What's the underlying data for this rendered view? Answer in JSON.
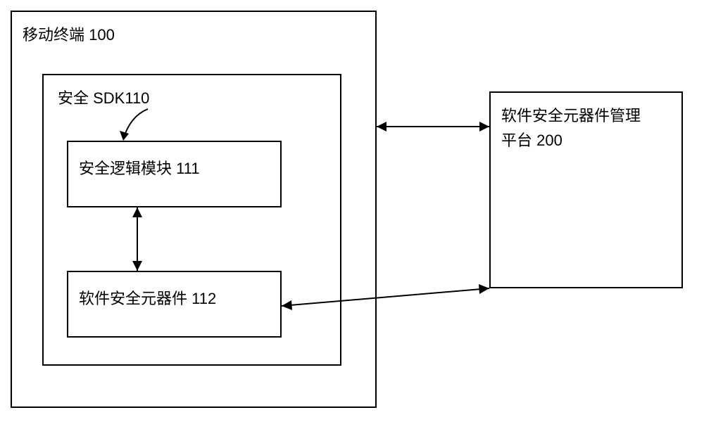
{
  "terminal": {
    "label": "移动终端 100"
  },
  "sdk": {
    "label": "安全 SDK110"
  },
  "logic_module": {
    "label": "安全逻辑模块 111"
  },
  "security_component": {
    "label": "软件安全元器件 112"
  },
  "platform": {
    "label_line1": "软件安全元器件管理",
    "label_line2": "平台 200"
  }
}
